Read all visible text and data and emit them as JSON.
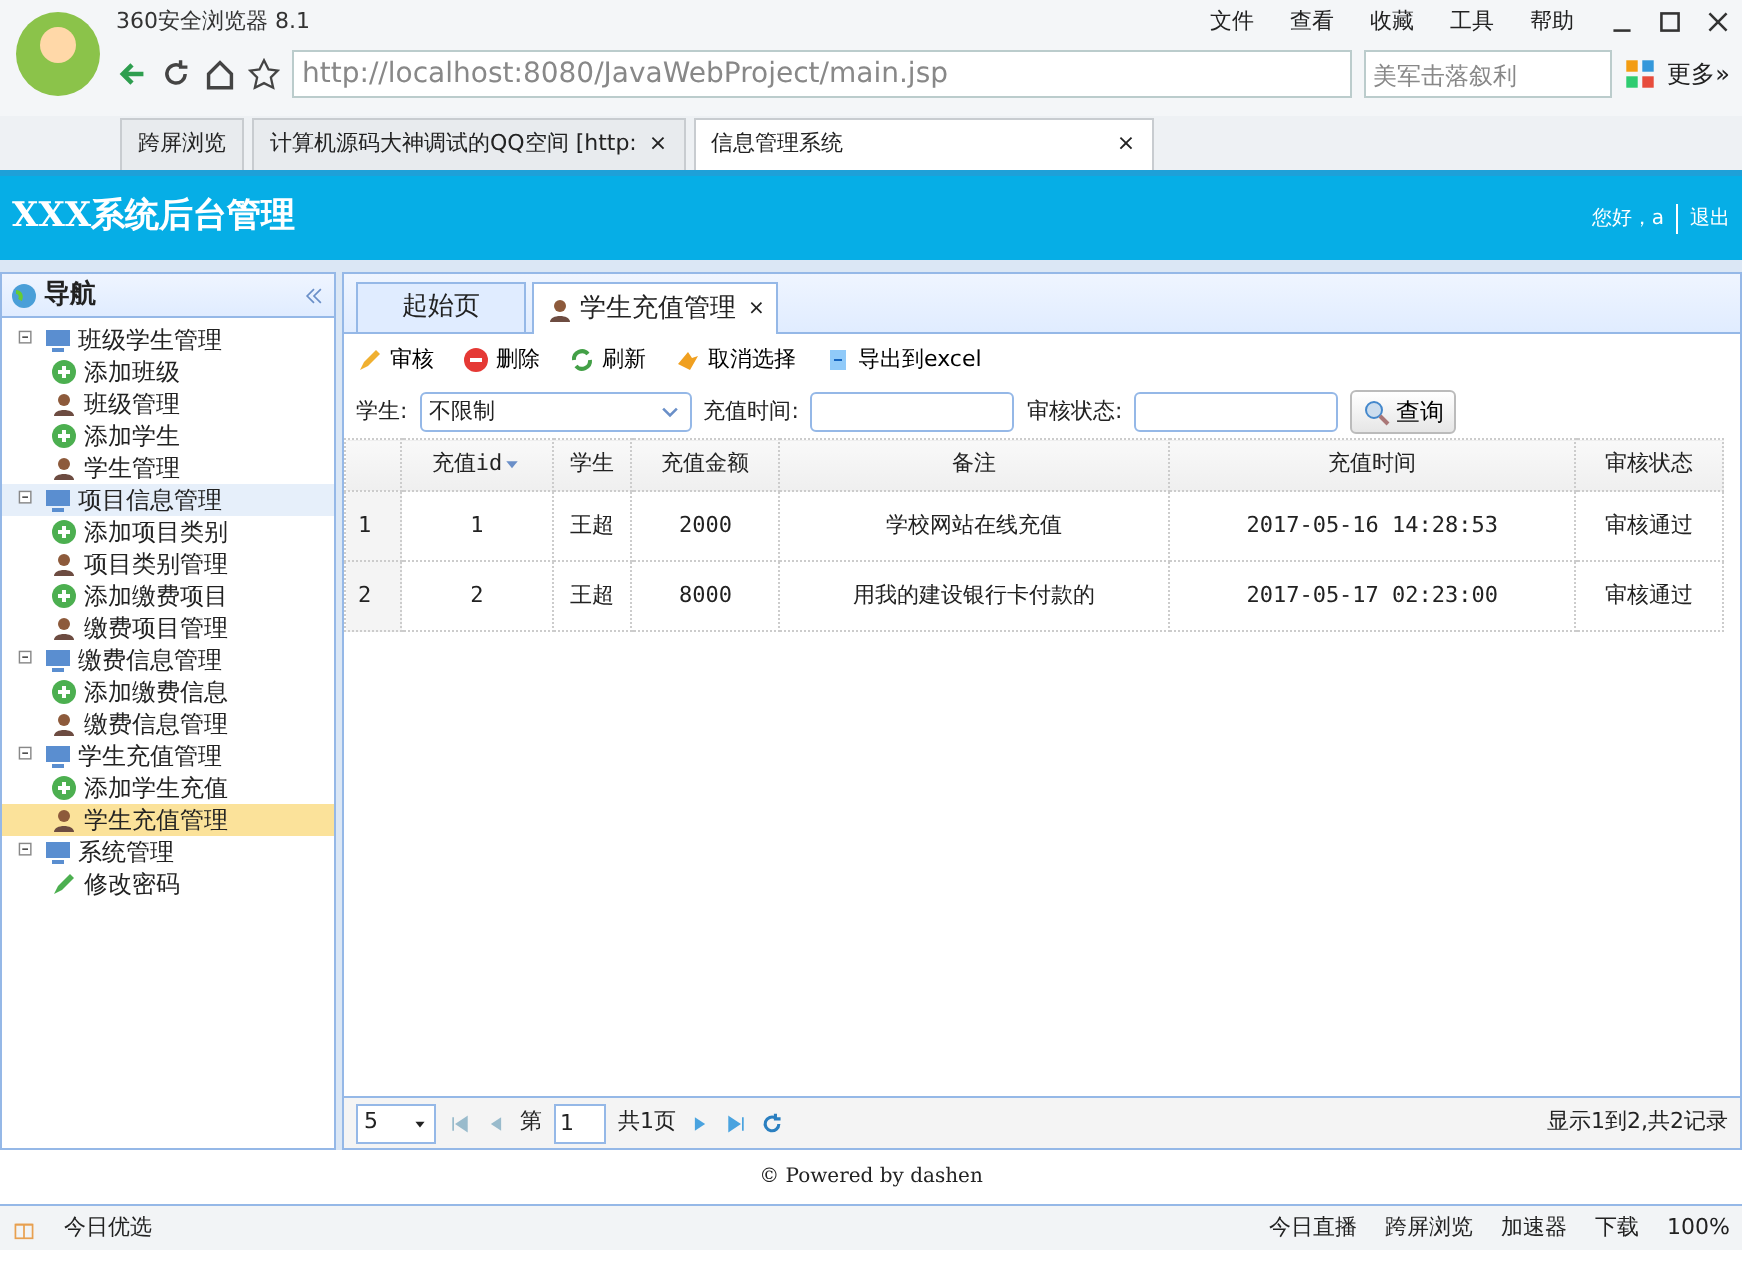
{
  "browser": {
    "title": "360安全浏览器 8.1",
    "menu": [
      "文件",
      "查看",
      "收藏",
      "工具",
      "帮助"
    ],
    "address": "http://localhost:8080/JavaWebProject/main.jsp",
    "search_placeholder": "美军击落叙利",
    "more": "更多»",
    "tabs": [
      {
        "label": "跨屏浏览",
        "selected": false
      },
      {
        "label": "计算机源码大神调试的QQ空间 [http:",
        "selected": false,
        "close": "×"
      },
      {
        "label": "信息管理系统",
        "selected": true,
        "close": "×"
      }
    ]
  },
  "app": {
    "title": "XXX系统后台管理",
    "greeting": "您好，a",
    "logout": "退出",
    "nav": {
      "title": "导航",
      "tree": [
        {
          "label": "班级学生管理",
          "expanded": true,
          "selected": false,
          "hover": false,
          "children": [
            {
              "label": "添加班级",
              "kind": "add",
              "selected": false
            },
            {
              "label": "班级管理",
              "kind": "manage",
              "selected": false
            },
            {
              "label": "添加学生",
              "kind": "add",
              "selected": false
            },
            {
              "label": "学生管理",
              "kind": "manage",
              "selected": false
            }
          ]
        },
        {
          "label": "项目信息管理",
          "expanded": true,
          "selected": false,
          "hover": true,
          "children": [
            {
              "label": "添加项目类别",
              "kind": "add",
              "selected": false
            },
            {
              "label": "项目类别管理",
              "kind": "manage",
              "selected": false
            },
            {
              "label": "添加缴费项目",
              "kind": "add",
              "selected": false
            },
            {
              "label": "缴费项目管理",
              "kind": "manage",
              "selected": false
            }
          ]
        },
        {
          "label": "缴费信息管理",
          "expanded": true,
          "selected": false,
          "hover": false,
          "children": [
            {
              "label": "添加缴费信息",
              "kind": "add",
              "selected": false
            },
            {
              "label": "缴费信息管理",
              "kind": "manage",
              "selected": false
            }
          ]
        },
        {
          "label": "学生充值管理",
          "expanded": true,
          "selected": false,
          "hover": false,
          "children": [
            {
              "label": "添加学生充值",
              "kind": "add",
              "selected": false
            },
            {
              "label": "学生充值管理",
              "kind": "manage",
              "selected": true
            }
          ]
        },
        {
          "label": "系统管理",
          "expanded": true,
          "selected": false,
          "hover": false,
          "children": [
            {
              "label": "修改密码",
              "kind": "edit",
              "selected": false
            }
          ]
        }
      ]
    },
    "tabs": [
      {
        "label": "起始页",
        "selected": false
      },
      {
        "label": "学生充值管理",
        "selected": true,
        "close": "×"
      }
    ],
    "toolbar": [
      {
        "label": "审核",
        "kind": "edit"
      },
      {
        "label": "删除",
        "kind": "delete"
      },
      {
        "label": "刷新",
        "kind": "refresh"
      },
      {
        "label": "取消选择",
        "kind": "undo"
      },
      {
        "label": "导出到excel",
        "kind": "export"
      }
    ],
    "filters": [
      {
        "label": "学生:",
        "kind": "select",
        "value": "不限制"
      },
      {
        "label": "充值时间:",
        "kind": "text"
      },
      {
        "label": "审核状态:",
        "kind": "text"
      }
    ],
    "search_button": "查询",
    "table": {
      "columns": [
        {
          "label": "充值id",
          "sorted": true
        },
        {
          "label": "学生",
          "sorted": false
        },
        {
          "label": "充值金额",
          "sorted": false
        },
        {
          "label": "备注",
          "sorted": false
        },
        {
          "label": "充值时间",
          "sorted": false
        },
        {
          "label": "审核状态",
          "sorted": false
        }
      ],
      "rows": [
        {
          "num": "1",
          "cells": [
            "1",
            "王超",
            "2000",
            "学校网站在线充值",
            "2017-05-16 14:28:53",
            "审核通过"
          ]
        },
        {
          "num": "2",
          "cells": [
            "2",
            "王超",
            "8000",
            "用我的建设银行卡付款的",
            "2017-05-17 02:23:00",
            "审核通过"
          ]
        }
      ]
    },
    "pager": {
      "page_size": "5",
      "before": "第",
      "page": "1",
      "after": "共1页",
      "summary": "显示1到2,共2记录"
    },
    "footer": "© Powered by dashen"
  },
  "status_bar": {
    "left": "今日优选",
    "items": [
      "今日直播",
      "跨屏浏览",
      "加速器",
      "下载"
    ],
    "zoom": "100%"
  }
}
